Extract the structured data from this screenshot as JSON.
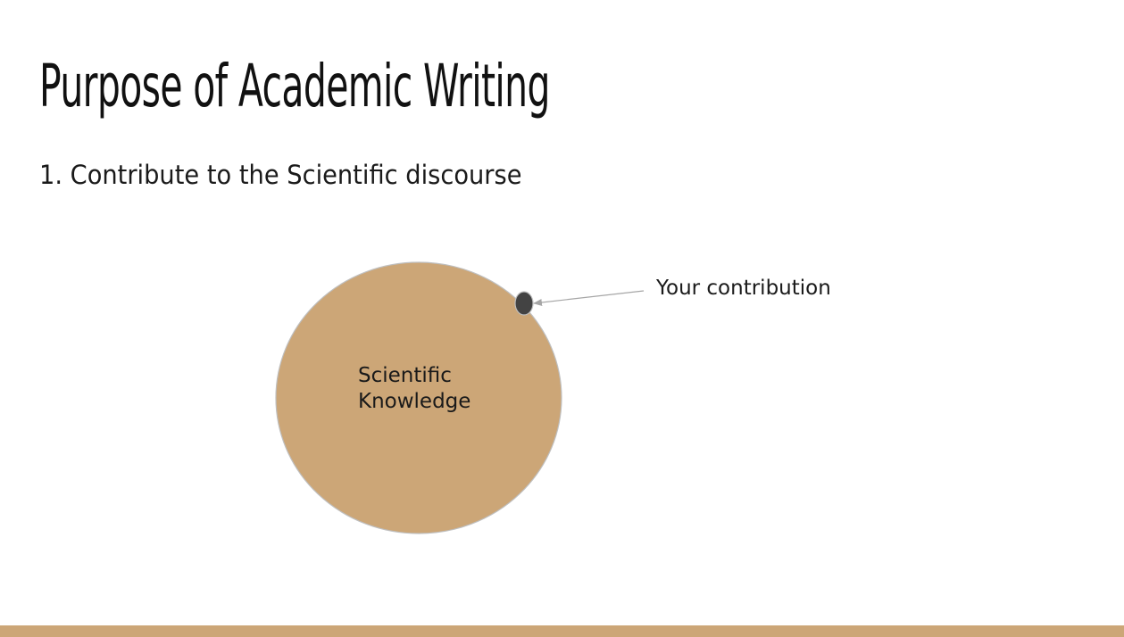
{
  "slide": {
    "title": "Purpose of Academic Writing",
    "subtitle": "1. Contribute to the Scientific discourse"
  },
  "diagram": {
    "circle_label_line1": "Scientific",
    "circle_label_line2": "Knowledge",
    "contribution_label": "Your contribution"
  },
  "colors": {
    "accent": "#cca677",
    "circle_fill": "#cca677",
    "circle_stroke": "#bfbfbf",
    "dot_fill": "#434343",
    "arrow_color": "#a6a6a6"
  }
}
